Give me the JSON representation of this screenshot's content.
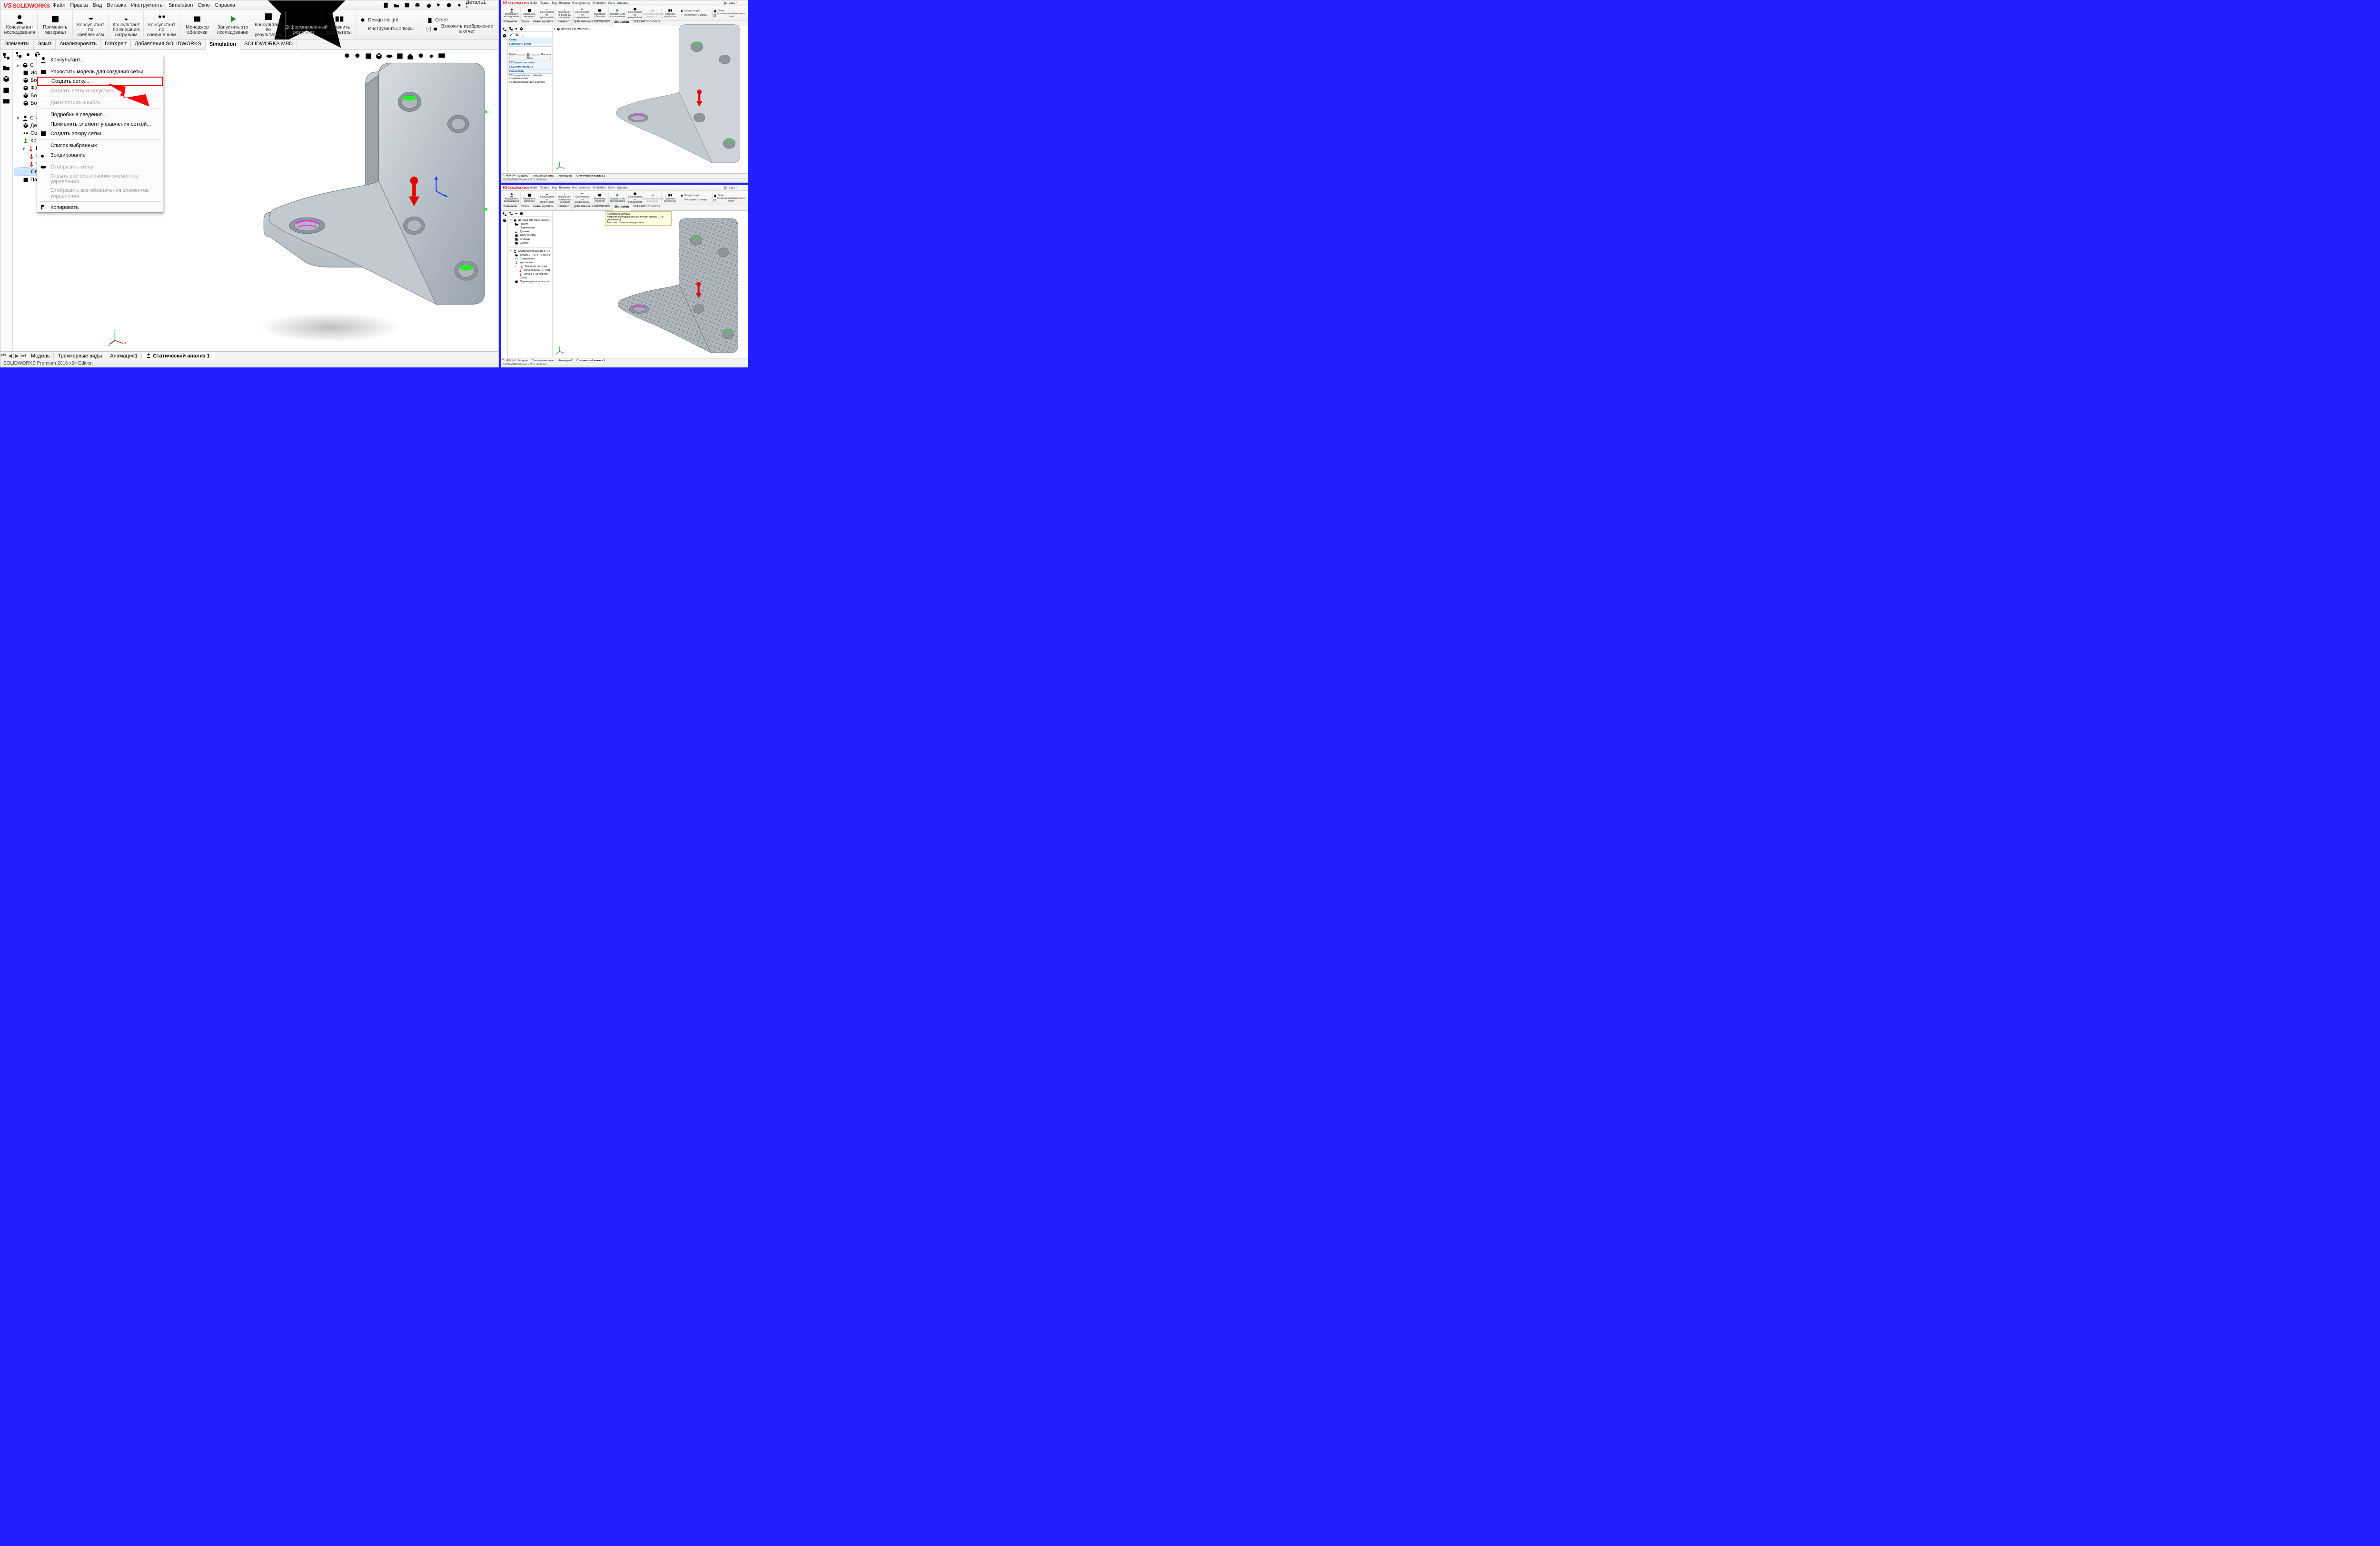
{
  "app": {
    "brand": "SOLIDWORKS",
    "doc_title": "Деталь1 *",
    "menus": [
      "Файл",
      "Правка",
      "Вид",
      "Вставка",
      "Инструменты",
      "Simulation",
      "Окно",
      "Справка"
    ]
  },
  "ribbon": {
    "groups": [
      {
        "label": "Консультант исследования",
        "icon": "advisor"
      },
      {
        "label": "Применить материал",
        "icon": "material"
      },
      {
        "label": "Консультант по креплениям",
        "icon": "fixture"
      },
      {
        "label": "Консультант по внешним нагрузкам",
        "icon": "load"
      },
      {
        "label": "Консультант по соединениям",
        "icon": "connector"
      },
      {
        "label": "Менеджер оболочки",
        "icon": "shell"
      },
      {
        "label": "Запустить это исследование",
        "icon": "run"
      },
      {
        "label": "Консультант по результатам",
        "icon": "results"
      },
      {
        "label": "Деформированный результат",
        "icon": "deformed",
        "dim": true
      },
      {
        "label": "Сравнить результаты",
        "icon": "compare"
      }
    ],
    "sidecol1": [
      {
        "label": "Design Insight",
        "icon": "insight",
        "dim": true
      },
      {
        "label": "Инструменты эпюры",
        "icon": "plot-tools",
        "dim": true
      }
    ],
    "sidecol2": [
      {
        "label": "Отчет",
        "icon": "report"
      },
      {
        "label": "Включить изображение в отчет",
        "icon": "incl-img",
        "check": true
      }
    ]
  },
  "featuretabs": [
    "Элементы",
    "Эскиз",
    "Анализировать",
    "DimXpert",
    "Добавления SOLIDWORKS",
    "Simulation",
    "SOLIDWORKS MBD"
  ],
  "featuretabs_active": "Simulation",
  "tree_top": [
    "С",
    "Ис",
    "Боб",
    "Фас",
    "Боб",
    "Боб"
  ],
  "sim_tree": {
    "root": "Статичес",
    "children": [
      {
        "label": "Дет"
      },
      {
        "label": "Сое"
      },
      {
        "label": "Кре"
      },
      {
        "label": "Вне",
        "expanded": true,
        "children": [
          {
            "label": "С"
          },
          {
            "label": "С"
          }
        ]
      },
      {
        "label": "Сетка",
        "selected": true
      },
      {
        "label": "Параметры результатов"
      }
    ]
  },
  "ctx": {
    "items": [
      {
        "label": "Консультант..."
      },
      {
        "sep": true
      },
      {
        "label": "Упростить модель для создания сетки"
      },
      {
        "label": "Создать сетку...",
        "highlight": true
      },
      {
        "label": "Создать сетку и запустить",
        "dis": true
      },
      {
        "sep": true
      },
      {
        "label": "Диагностика ошибок...",
        "dis": true
      },
      {
        "sep": true
      },
      {
        "label": "Подробные сведения..."
      },
      {
        "label": "Применить элемент управления сеткой..."
      },
      {
        "label": "Создать эпюру сетки..."
      },
      {
        "sep": true
      },
      {
        "label": "Список выбранных"
      },
      {
        "label": "Зондирование"
      },
      {
        "sep": true
      },
      {
        "label": "Отобразить сетку",
        "dis": true
      },
      {
        "label": "Скрыть все обозначения элементов управления",
        "dis": true
      },
      {
        "label": "Отобразить все обозначения элементов управления",
        "dis": true
      },
      {
        "sep": true
      },
      {
        "label": "Копировать"
      }
    ]
  },
  "bottom_tabs": [
    "Модель",
    "Трехмерные виды",
    "Анимация1",
    "Статический анализ 1"
  ],
  "bottom_active": "Статический анализ 1",
  "statusbar": "SOLIDWORKS Premium 2016 x64 Edition",
  "mini_top": {
    "fm_header": "Деталь1 (По умолчани...",
    "prop": {
      "title": "Сетка",
      "density_label": "Плотность сетки",
      "coarse": "Грубое",
      "fine": "Высокое",
      "reset": "Сброс",
      "params": "Параметры сетки",
      "advanced": "Дополнительно",
      "opts": "Параметры",
      "opt1": "Сохранить настройки без создания сетки",
      "opt2": "Запуск (решение) анализа"
    },
    "bottom_tabs": [
      "Модель",
      "Трехмерные виды",
      "Анимация1",
      "Статический анализ 1"
    ],
    "status": "SOLIDWORKS Premium 2016 x64 Edition"
  },
  "mini_bot": {
    "balloon": {
      "l1": "Имя модели:Деталь1",
      "l2": "Название исследования:Статический анализ 1(-По умолчанию-)",
      "l3": "Тип сетки: Сетка на твердом теле"
    },
    "feature_tree": [
      "Деталь1 (По умолчанию<<По умол",
      "History",
      "Примечания",
      "Датчики",
      "7075-T6 (SN)",
      "Спереди",
      "Сверху"
    ],
    "sim_tree": {
      "root": "Статический анализ 1 (-По умолчан",
      "items": [
        "Деталь1 (-7075-T6 (SN)-)",
        "Соединения",
        "Крепления",
        {
          "label": "Внешние нагрузки",
          "children": [
            "Сила тяжести-1 (-9.81 m/s^2-)",
            "Сила-1 (-На объект: -1050 N-)"
          ]
        },
        "Сетка",
        "Параметры результатов"
      ]
    },
    "bottom_tabs": [
      "Модель",
      "Трехмерные виды",
      "Анимация1",
      "Статический анализ 1"
    ],
    "status": "SOLIDWORKS Premium 2016 x64 Edition"
  }
}
